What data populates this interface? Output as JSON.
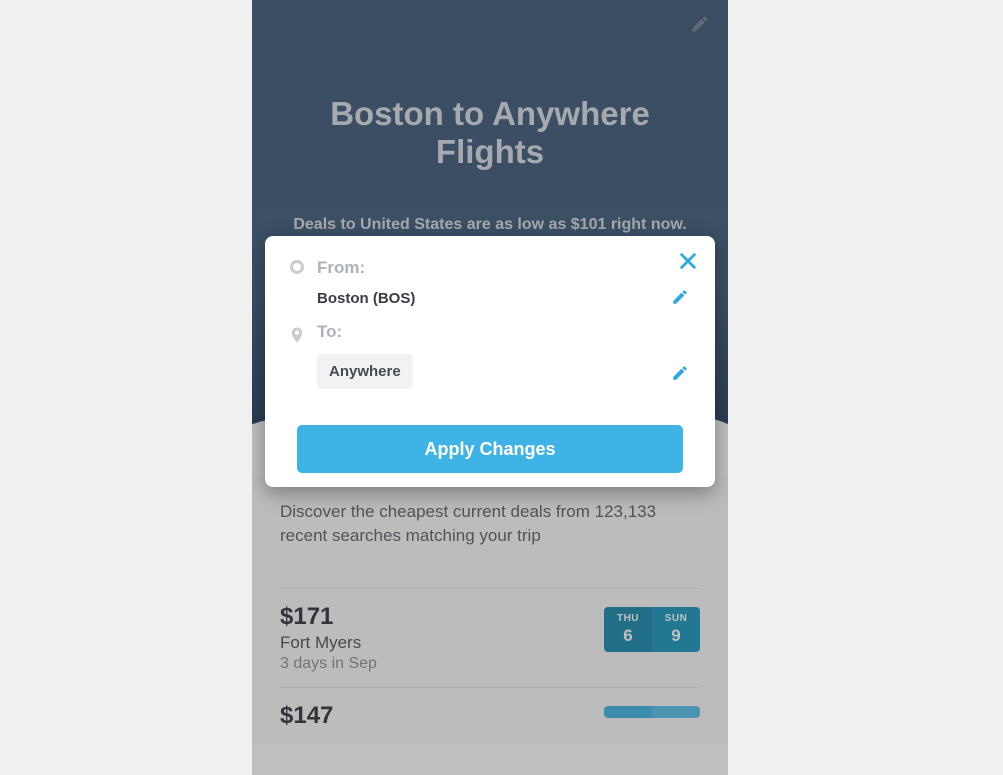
{
  "hero": {
    "title": "Boston to Anywhere Flights",
    "subtitle": "Deals to United States are as low as $101 right now."
  },
  "results": {
    "desc": "Discover the cheapest current deals from 123,133 recent searches matching your trip",
    "deals": [
      {
        "price": "$171",
        "dest": "Fort Myers",
        "dur": "3 days in Sep",
        "out_dow": "THU",
        "out_day": "6",
        "ret_dow": "SUN",
        "ret_day": "9"
      },
      {
        "price": "$147",
        "dest": "",
        "dur": "",
        "out_dow": "",
        "out_day": "",
        "ret_dow": "",
        "ret_day": ""
      }
    ]
  },
  "modal": {
    "from_label": "From:",
    "from_value": "Boston (BOS)",
    "to_label": "To:",
    "to_value": "Anywhere",
    "apply": "Apply Changes"
  }
}
